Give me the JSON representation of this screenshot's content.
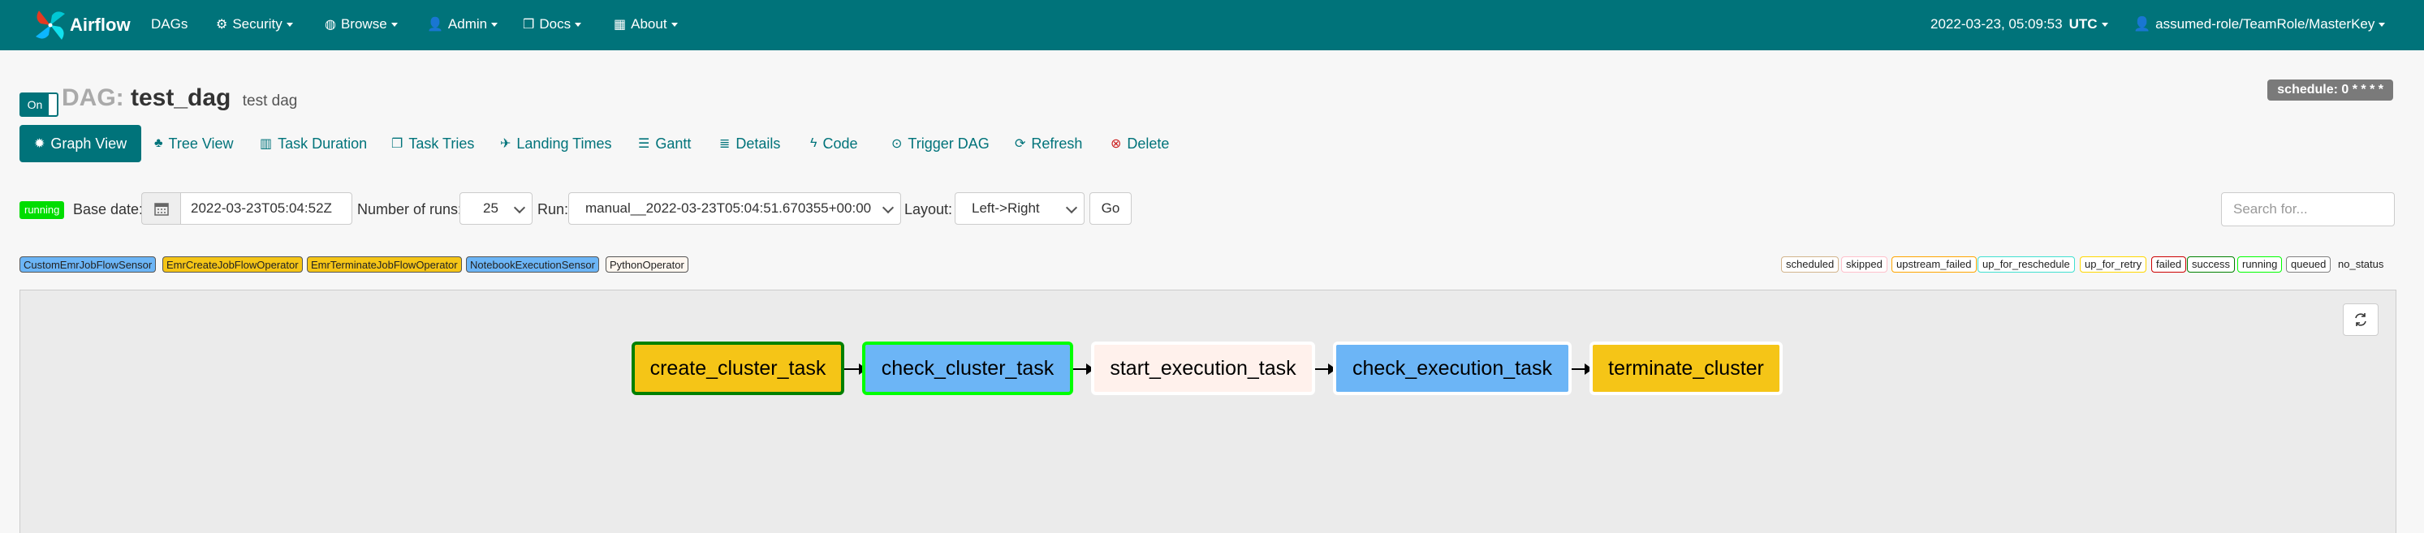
{
  "navbar": {
    "brand": "Airflow",
    "menu": [
      {
        "label": "DAGs",
        "icon": ""
      },
      {
        "label": "Security",
        "icon": "gear-icon"
      },
      {
        "label": "Browse",
        "icon": "globe-icon"
      },
      {
        "label": "Admin",
        "icon": "user-icon"
      },
      {
        "label": "Docs",
        "icon": "cube-icon"
      },
      {
        "label": "About",
        "icon": "grid-icon"
      }
    ],
    "datetime": "2022-03-23, 05:09:53",
    "timezone": "UTC",
    "user": "assumed-role/TeamRole/MasterKey"
  },
  "header": {
    "toggle_label": "On",
    "dag_label": "DAG:",
    "dag_id": "test_dag",
    "description": "test dag",
    "schedule": "schedule: 0 * * * *"
  },
  "tabs": [
    {
      "label": "Graph View",
      "icon": "graph-icon",
      "active": true
    },
    {
      "label": "Tree View",
      "icon": "tree-icon"
    },
    {
      "label": "Task Duration",
      "icon": "bar-chart-icon"
    },
    {
      "label": "Task Tries",
      "icon": "duplicate-icon"
    },
    {
      "label": "Landing Times",
      "icon": "plane-icon"
    },
    {
      "label": "Gantt",
      "icon": "gantt-icon"
    },
    {
      "label": "Details",
      "icon": "list-icon"
    },
    {
      "label": "Code",
      "icon": "flash-icon"
    },
    {
      "label": "Trigger DAG",
      "icon": "play-icon"
    },
    {
      "label": "Refresh",
      "icon": "refresh-icon"
    },
    {
      "label": "Delete",
      "icon": "delete-icon"
    }
  ],
  "filters": {
    "state": "running",
    "base_date_label": "Base date:",
    "base_date": "2022-03-23T05:04:52Z",
    "num_runs_label": "Number of runs:",
    "num_runs": "25",
    "run_label": "Run:",
    "run": "manual__2022-03-23T05:04:51.670355+00:00",
    "layout_label": "Layout:",
    "layout": "Left->Right",
    "go_label": "Go",
    "search_placeholder": "Search for..."
  },
  "operators": [
    {
      "label": "CustomEmrJobFlowSensor",
      "color": "#6cb5f6"
    },
    {
      "label": "EmrCreateJobFlowOperator",
      "color": "#f5c517"
    },
    {
      "label": "EmrTerminateJobFlowOperator",
      "color": "#f5c517"
    },
    {
      "label": "NotebookExecutionSensor",
      "color": "#6cb5f6"
    },
    {
      "label": "PythonOperator",
      "color": "#fff7f0"
    }
  ],
  "states": [
    {
      "label": "scheduled",
      "border": "#d2b48c"
    },
    {
      "label": "skipped",
      "border": "#ffc0cb"
    },
    {
      "label": "upstream_failed",
      "border": "#ffa500"
    },
    {
      "label": "up_for_reschedule",
      "border": "#40e0d0"
    },
    {
      "label": "up_for_retry",
      "border": "#ffd700"
    },
    {
      "label": "failed",
      "border": "#cc0000"
    },
    {
      "label": "success",
      "border": "#008000"
    },
    {
      "label": "running",
      "border": "#00ff00"
    },
    {
      "label": "queued",
      "border": "#808080"
    },
    {
      "label": "no_status",
      "border": "none"
    }
  ],
  "tasks": [
    {
      "label": "create_cluster_task",
      "fill": "#f5c517",
      "state_border": "#008000"
    },
    {
      "label": "check_cluster_task",
      "fill": "#6cb5f6",
      "state_border": "#00ff00"
    },
    {
      "label": "start_execution_task",
      "fill": "#fff1ec",
      "state_border": "#ffffff"
    },
    {
      "label": "check_execution_task",
      "fill": "#6cb5f6",
      "state_border": "#ffffff"
    },
    {
      "label": "terminate_cluster",
      "fill": "#f5c517",
      "state_border": "#ffffff"
    }
  ]
}
